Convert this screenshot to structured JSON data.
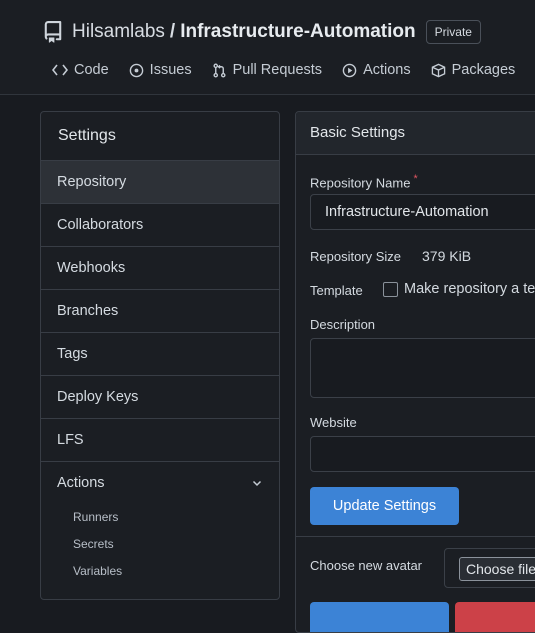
{
  "repo": {
    "owner": "Hilsamlabs",
    "separator": "/",
    "name": "Infrastructure-Automation",
    "visibility": "Private"
  },
  "tabs": [
    {
      "label": "Code",
      "icon": "code-icon"
    },
    {
      "label": "Issues",
      "icon": "issue-icon"
    },
    {
      "label": "Pull Requests",
      "icon": "pull-request-icon"
    },
    {
      "label": "Actions",
      "icon": "play-icon"
    },
    {
      "label": "Packages",
      "icon": "package-icon"
    }
  ],
  "sidebar": {
    "title": "Settings",
    "items": [
      "Repository",
      "Collaborators",
      "Webhooks",
      "Branches",
      "Tags",
      "Deploy Keys",
      "LFS"
    ],
    "active": "Repository",
    "actions": {
      "label": "Actions",
      "children": [
        "Runners",
        "Secrets",
        "Variables"
      ]
    }
  },
  "basic_settings": {
    "title": "Basic Settings",
    "repo_name_label": "Repository Name",
    "required_mark": "*",
    "repo_name_value": "Infrastructure-Automation",
    "repo_size_label": "Repository Size",
    "repo_size_value": "379 KiB",
    "template_label": "Template",
    "template_checkbox_label": "Make repository a te",
    "description_label": "Description",
    "description_value": "",
    "website_label": "Website",
    "website_value": "",
    "update_button": "Update Settings",
    "avatar_label": "Choose new avatar",
    "choose_file_button": "Choose file"
  },
  "colors": {
    "primary": "#3c83d6",
    "danger": "#cc4148",
    "background": "#181b20"
  }
}
